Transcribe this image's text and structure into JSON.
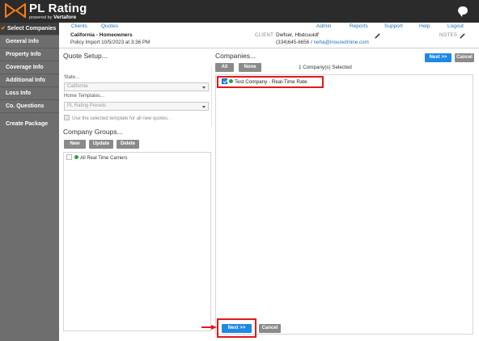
{
  "app": {
    "title": "PL Rating",
    "powered_by": "powered by",
    "brand": "Vertafore"
  },
  "sidebar": {
    "items": [
      {
        "label": "Select Companies",
        "active": true
      },
      {
        "label": "General Info"
      },
      {
        "label": "Property Info"
      },
      {
        "label": "Coverage Info"
      },
      {
        "label": "Additional Info"
      },
      {
        "label": "Loss Info"
      },
      {
        "label": "Co. Questions"
      },
      {
        "label": "Create Package"
      }
    ]
  },
  "nav": {
    "clients": "Clients",
    "quotes": "Quotes",
    "admin": "Admin",
    "reports": "Reports",
    "support": "Support",
    "help": "Help",
    "logout": "Logout"
  },
  "policy": {
    "title": "California - Homeowners",
    "import": "Policy Import 10/5/2023 at 3:36 PM"
  },
  "client": {
    "label": "CLIENT",
    "name": "Dwfser, Hbdcuuidf",
    "phone": "(334)645-6656 / ",
    "email": "neha@insuredmine.com"
  },
  "notes": {
    "label": "NOTES"
  },
  "quote_setup": {
    "title": "Quote Setup...",
    "state_label": "State...",
    "state_value": "California",
    "templates_label": "Home Templates...",
    "template_value": "PL Rating Presets",
    "use_template_label": "Use the selected template for all new quotes."
  },
  "company_groups": {
    "title": "Company Groups...",
    "new_label": "New",
    "update_label": "Update",
    "delete_label": "Delete",
    "items": [
      "All Real Time Carriers"
    ]
  },
  "companies": {
    "title": "Companies...",
    "all_label": "All",
    "none_label": "None",
    "selected_count": "1  Company(s) Selected",
    "items": [
      {
        "label": "Test Company - Real-Time Rate",
        "checked": true
      }
    ]
  },
  "actions": {
    "next_label": "Next >>",
    "cancel_label": "Cancel"
  },
  "colors": {
    "accent_blue": "#1e88e5",
    "highlight_red": "#e0191e",
    "sidebar_grey": "#6e6e6e",
    "topbar_dark": "#2b2b2b",
    "active_check": "#ff8c00"
  }
}
